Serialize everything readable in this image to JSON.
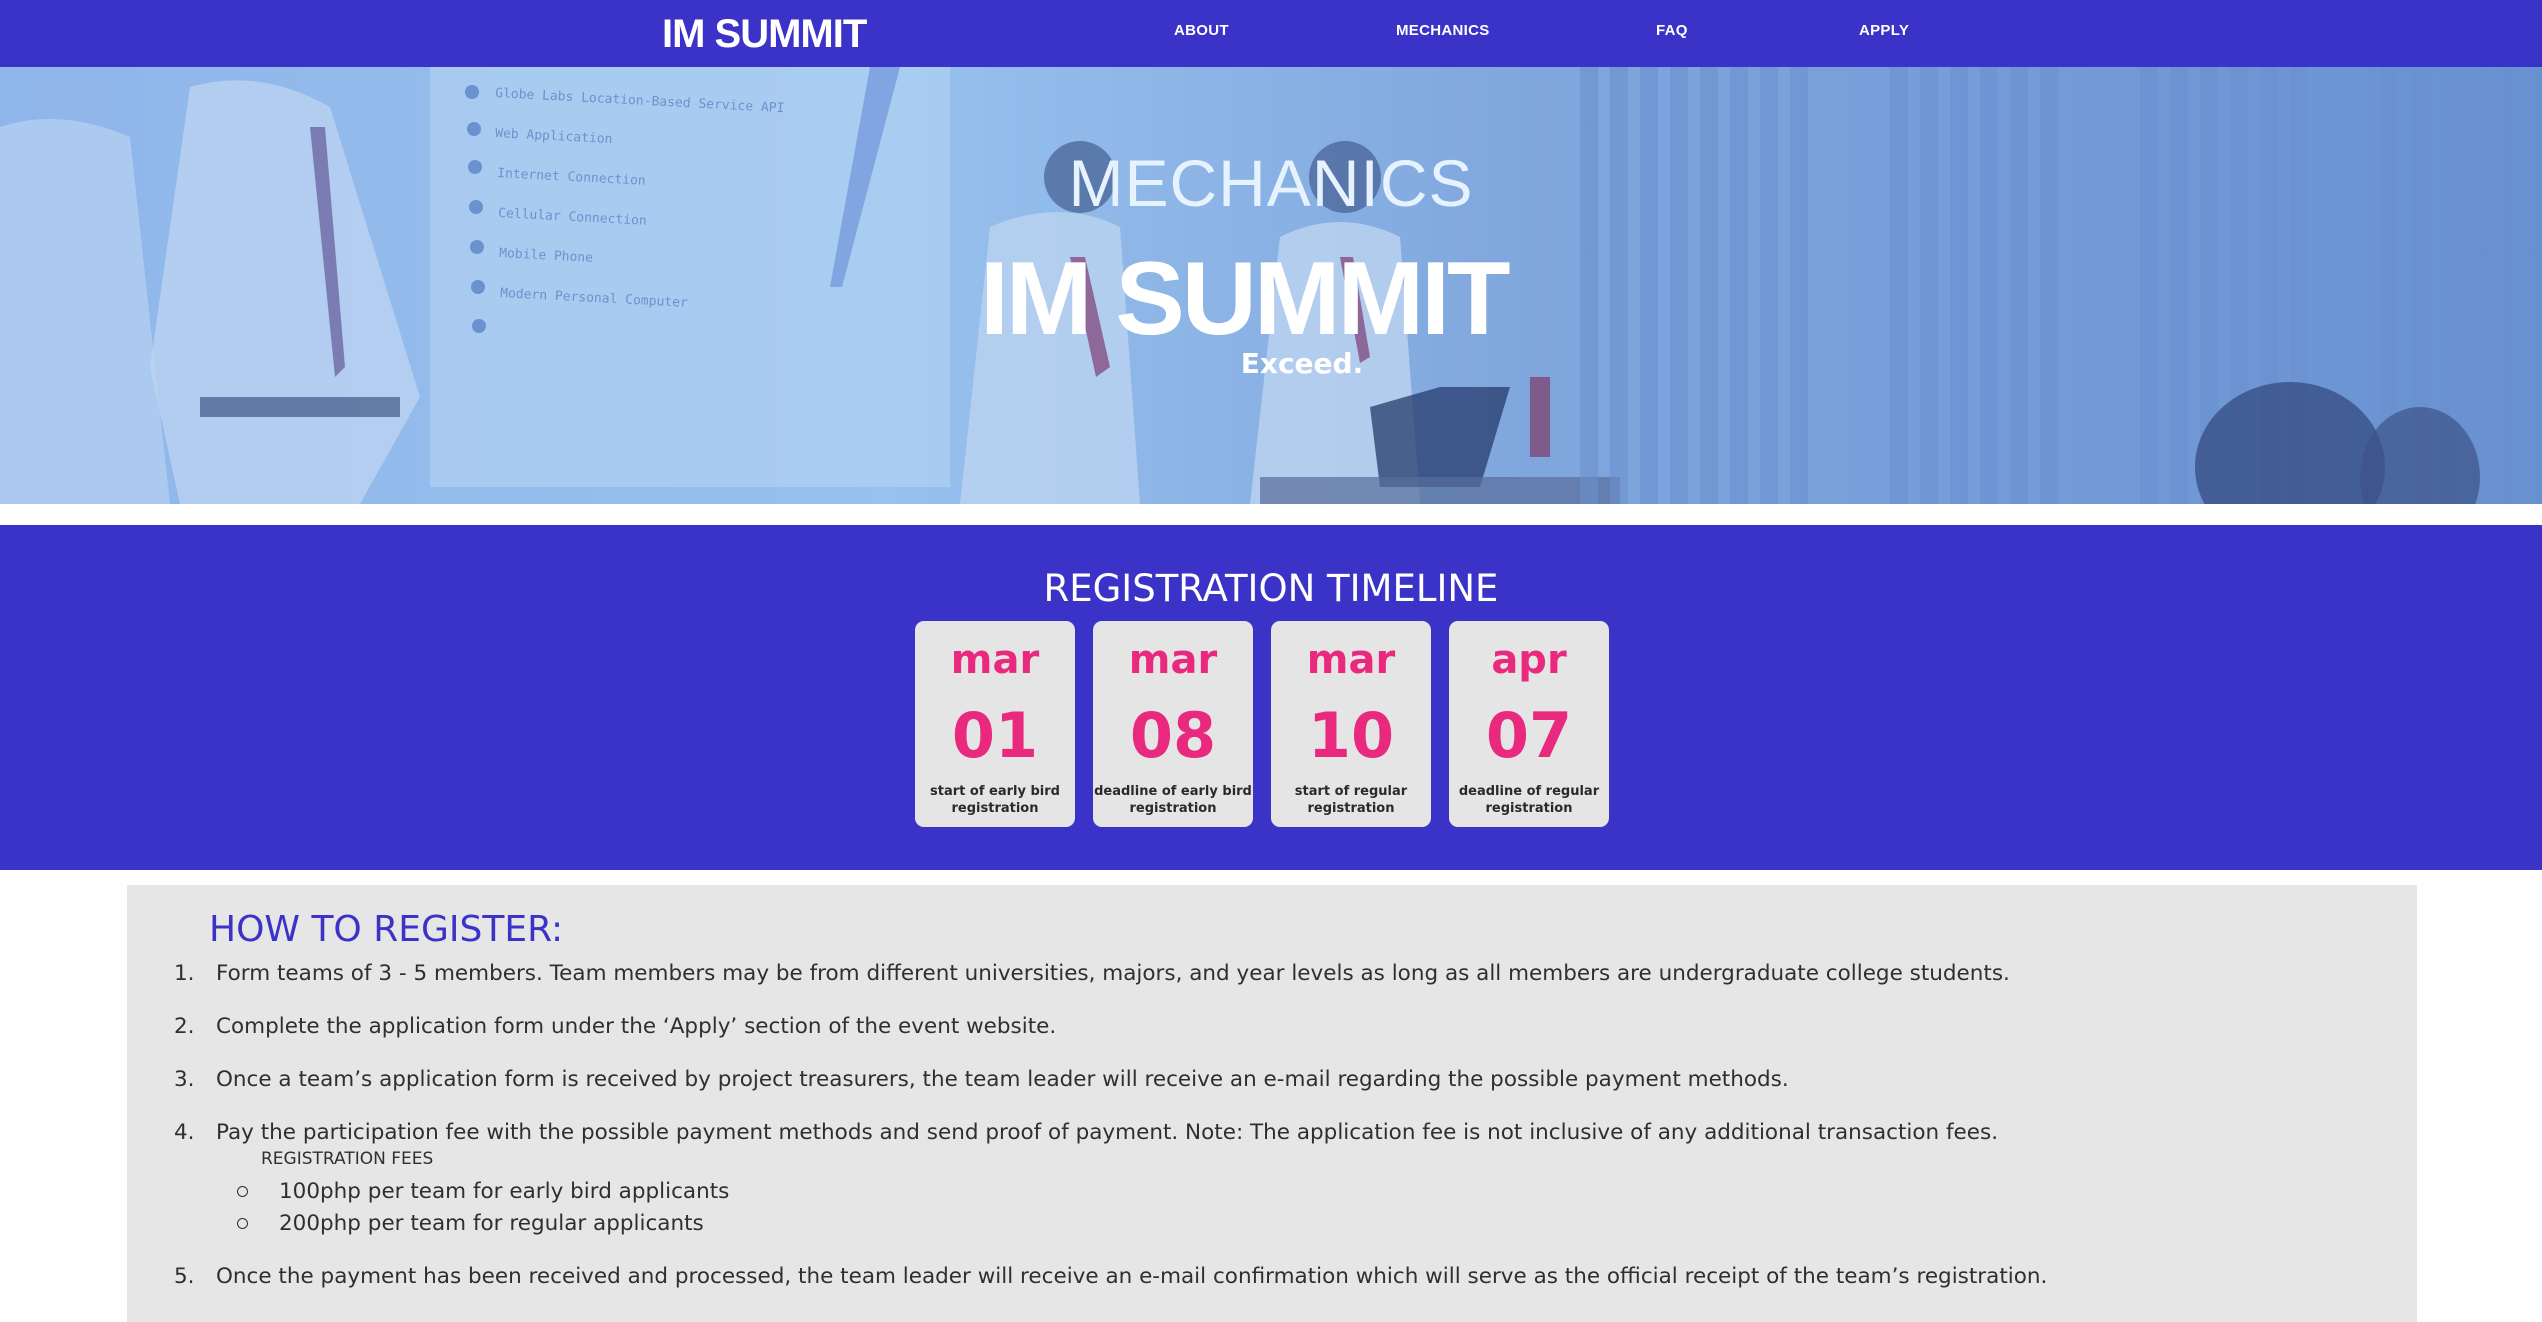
{
  "nav": {
    "logo_text": "IM SUMMIT",
    "links": [
      "ABOUT",
      "MECHANICS",
      "FAQ",
      "APPLY"
    ]
  },
  "hero": {
    "title": "MECHANICS",
    "logo_text": "IM SUMMIT",
    "tagline": "Exceed."
  },
  "timeline": {
    "title": "REGISTRATION TIMELINE",
    "cards": [
      {
        "month": "mar",
        "day": "01",
        "desc_line1": "start of early bird",
        "desc_line2": "registration"
      },
      {
        "month": "mar",
        "day": "08",
        "desc_line1": "deadline of early bird",
        "desc_line2": "registration"
      },
      {
        "month": "mar",
        "day": "10",
        "desc_line1": "start of regular",
        "desc_line2": "registration"
      },
      {
        "month": "apr",
        "day": "07",
        "desc_line1": "deadline of regular",
        "desc_line2": "registration"
      }
    ]
  },
  "howto": {
    "title": "HOW TO REGISTER:",
    "steps": [
      {
        "num": "1.",
        "text": "Form teams of 3 - 5 members. Team members may be from different universities, majors, and year levels as long as all members are undergraduate college students."
      },
      {
        "num": "2.",
        "text": "Complete the application form under the ‘Apply’ section of the event website."
      },
      {
        "num": "3.",
        "text": "Once a team’s application form is received by project treasurers, the team leader will receive an e-mail regarding the possible payment methods."
      },
      {
        "num": "4.",
        "text": "Pay the participation fee with the possible payment methods and send proof of payment. Note: The application fee is not inclusive of any additional transaction fees."
      },
      {
        "num": "5.",
        "text": "Once the payment has been received and processed, the team leader will receive an e-mail confirmation which will serve as the official receipt of the team’s registration."
      }
    ],
    "fees_heading": "REGISTRATION FEES",
    "fees": [
      "100php per team for early bird applicants",
      "200php per team for regular applicants"
    ]
  },
  "colors": {
    "brand": "#3b33c7",
    "accent": "#e8297d",
    "card_bg": "#e5e5e5",
    "section_bg": "#e6e6e6"
  }
}
